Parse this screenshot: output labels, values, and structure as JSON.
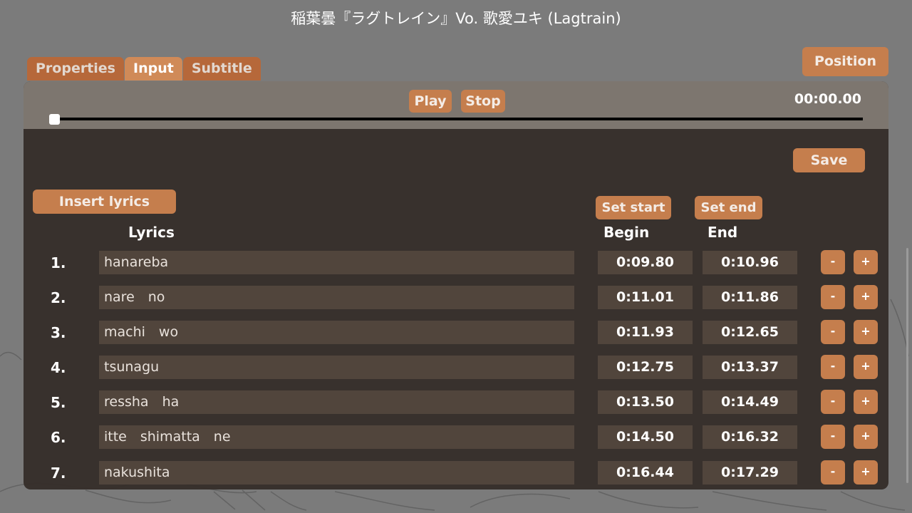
{
  "window_title": "稲葉曇『ラグトレイン』Vo. 歌愛ユキ (Lagtrain)",
  "tabs": [
    {
      "label": "Properties",
      "active": false
    },
    {
      "label": "Input",
      "active": true
    },
    {
      "label": "Subtitle",
      "active": false
    }
  ],
  "position_label": "Position",
  "player": {
    "play_label": "Play",
    "stop_label": "Stop",
    "current_time": "00:00.00",
    "progress": 0
  },
  "toolbar": {
    "save_label": "Save",
    "insert_lyrics_label": "Insert lyrics",
    "set_start_label": "Set start",
    "set_end_label": "Set end"
  },
  "columns": {
    "lyrics": "Lyrics",
    "begin": "Begin",
    "end": "End"
  },
  "rows": [
    {
      "num": "1.",
      "lyric": "hanareba",
      "begin": "0:09.80",
      "end": "0:10.96"
    },
    {
      "num": "2.",
      "lyric": "nare　no",
      "begin": "0:11.01",
      "end": "0:11.86"
    },
    {
      "num": "3.",
      "lyric": "machi　wo",
      "begin": "0:11.93",
      "end": "0:12.65"
    },
    {
      "num": "4.",
      "lyric": "tsunagu",
      "begin": "0:12.75",
      "end": "0:13.37"
    },
    {
      "num": "5.",
      "lyric": "ressha　ha",
      "begin": "0:13.50",
      "end": "0:14.49"
    },
    {
      "num": "6.",
      "lyric": "itte　shimatta　ne",
      "begin": "0:14.50",
      "end": "0:16.32"
    },
    {
      "num": "7.",
      "lyric": "nakushita",
      "begin": "0:16.44",
      "end": "0:17.29"
    }
  ],
  "row_button_minus": "-",
  "row_button_plus": "+",
  "colors": {
    "accent": "#c57e4d",
    "accent_active": "#d08a58",
    "panel": "#342d28",
    "field": "#51453c"
  }
}
